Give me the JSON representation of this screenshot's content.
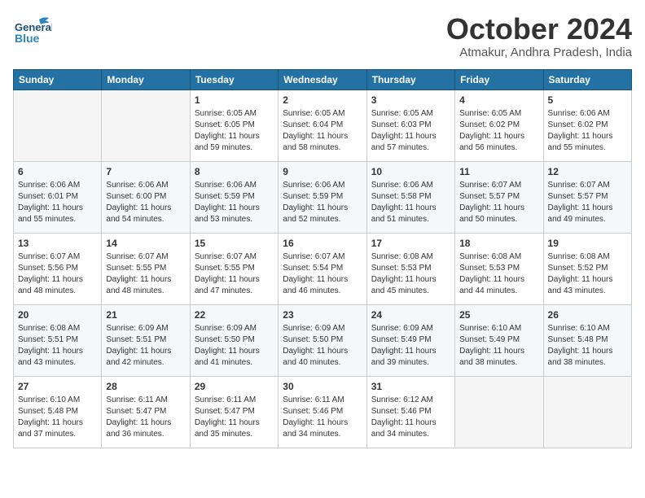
{
  "header": {
    "logo_line1": "General",
    "logo_line2": "Blue",
    "month_title": "October 2024",
    "location": "Atmakur, Andhra Pradesh, India"
  },
  "weekdays": [
    "Sunday",
    "Monday",
    "Tuesday",
    "Wednesday",
    "Thursday",
    "Friday",
    "Saturday"
  ],
  "weeks": [
    [
      {
        "day": "",
        "info": ""
      },
      {
        "day": "",
        "info": ""
      },
      {
        "day": "1",
        "info": "Sunrise: 6:05 AM\nSunset: 6:05 PM\nDaylight: 11 hours and 59 minutes."
      },
      {
        "day": "2",
        "info": "Sunrise: 6:05 AM\nSunset: 6:04 PM\nDaylight: 11 hours and 58 minutes."
      },
      {
        "day": "3",
        "info": "Sunrise: 6:05 AM\nSunset: 6:03 PM\nDaylight: 11 hours and 57 minutes."
      },
      {
        "day": "4",
        "info": "Sunrise: 6:05 AM\nSunset: 6:02 PM\nDaylight: 11 hours and 56 minutes."
      },
      {
        "day": "5",
        "info": "Sunrise: 6:06 AM\nSunset: 6:02 PM\nDaylight: 11 hours and 55 minutes."
      }
    ],
    [
      {
        "day": "6",
        "info": "Sunrise: 6:06 AM\nSunset: 6:01 PM\nDaylight: 11 hours and 55 minutes."
      },
      {
        "day": "7",
        "info": "Sunrise: 6:06 AM\nSunset: 6:00 PM\nDaylight: 11 hours and 54 minutes."
      },
      {
        "day": "8",
        "info": "Sunrise: 6:06 AM\nSunset: 5:59 PM\nDaylight: 11 hours and 53 minutes."
      },
      {
        "day": "9",
        "info": "Sunrise: 6:06 AM\nSunset: 5:59 PM\nDaylight: 11 hours and 52 minutes."
      },
      {
        "day": "10",
        "info": "Sunrise: 6:06 AM\nSunset: 5:58 PM\nDaylight: 11 hours and 51 minutes."
      },
      {
        "day": "11",
        "info": "Sunrise: 6:07 AM\nSunset: 5:57 PM\nDaylight: 11 hours and 50 minutes."
      },
      {
        "day": "12",
        "info": "Sunrise: 6:07 AM\nSunset: 5:57 PM\nDaylight: 11 hours and 49 minutes."
      }
    ],
    [
      {
        "day": "13",
        "info": "Sunrise: 6:07 AM\nSunset: 5:56 PM\nDaylight: 11 hours and 48 minutes."
      },
      {
        "day": "14",
        "info": "Sunrise: 6:07 AM\nSunset: 5:55 PM\nDaylight: 11 hours and 48 minutes."
      },
      {
        "day": "15",
        "info": "Sunrise: 6:07 AM\nSunset: 5:55 PM\nDaylight: 11 hours and 47 minutes."
      },
      {
        "day": "16",
        "info": "Sunrise: 6:07 AM\nSunset: 5:54 PM\nDaylight: 11 hours and 46 minutes."
      },
      {
        "day": "17",
        "info": "Sunrise: 6:08 AM\nSunset: 5:53 PM\nDaylight: 11 hours and 45 minutes."
      },
      {
        "day": "18",
        "info": "Sunrise: 6:08 AM\nSunset: 5:53 PM\nDaylight: 11 hours and 44 minutes."
      },
      {
        "day": "19",
        "info": "Sunrise: 6:08 AM\nSunset: 5:52 PM\nDaylight: 11 hours and 43 minutes."
      }
    ],
    [
      {
        "day": "20",
        "info": "Sunrise: 6:08 AM\nSunset: 5:51 PM\nDaylight: 11 hours and 43 minutes."
      },
      {
        "day": "21",
        "info": "Sunrise: 6:09 AM\nSunset: 5:51 PM\nDaylight: 11 hours and 42 minutes."
      },
      {
        "day": "22",
        "info": "Sunrise: 6:09 AM\nSunset: 5:50 PM\nDaylight: 11 hours and 41 minutes."
      },
      {
        "day": "23",
        "info": "Sunrise: 6:09 AM\nSunset: 5:50 PM\nDaylight: 11 hours and 40 minutes."
      },
      {
        "day": "24",
        "info": "Sunrise: 6:09 AM\nSunset: 5:49 PM\nDaylight: 11 hours and 39 minutes."
      },
      {
        "day": "25",
        "info": "Sunrise: 6:10 AM\nSunset: 5:49 PM\nDaylight: 11 hours and 38 minutes."
      },
      {
        "day": "26",
        "info": "Sunrise: 6:10 AM\nSunset: 5:48 PM\nDaylight: 11 hours and 38 minutes."
      }
    ],
    [
      {
        "day": "27",
        "info": "Sunrise: 6:10 AM\nSunset: 5:48 PM\nDaylight: 11 hours and 37 minutes."
      },
      {
        "day": "28",
        "info": "Sunrise: 6:11 AM\nSunset: 5:47 PM\nDaylight: 11 hours and 36 minutes."
      },
      {
        "day": "29",
        "info": "Sunrise: 6:11 AM\nSunset: 5:47 PM\nDaylight: 11 hours and 35 minutes."
      },
      {
        "day": "30",
        "info": "Sunrise: 6:11 AM\nSunset: 5:46 PM\nDaylight: 11 hours and 34 minutes."
      },
      {
        "day": "31",
        "info": "Sunrise: 6:12 AM\nSunset: 5:46 PM\nDaylight: 11 hours and 34 minutes."
      },
      {
        "day": "",
        "info": ""
      },
      {
        "day": "",
        "info": ""
      }
    ]
  ]
}
